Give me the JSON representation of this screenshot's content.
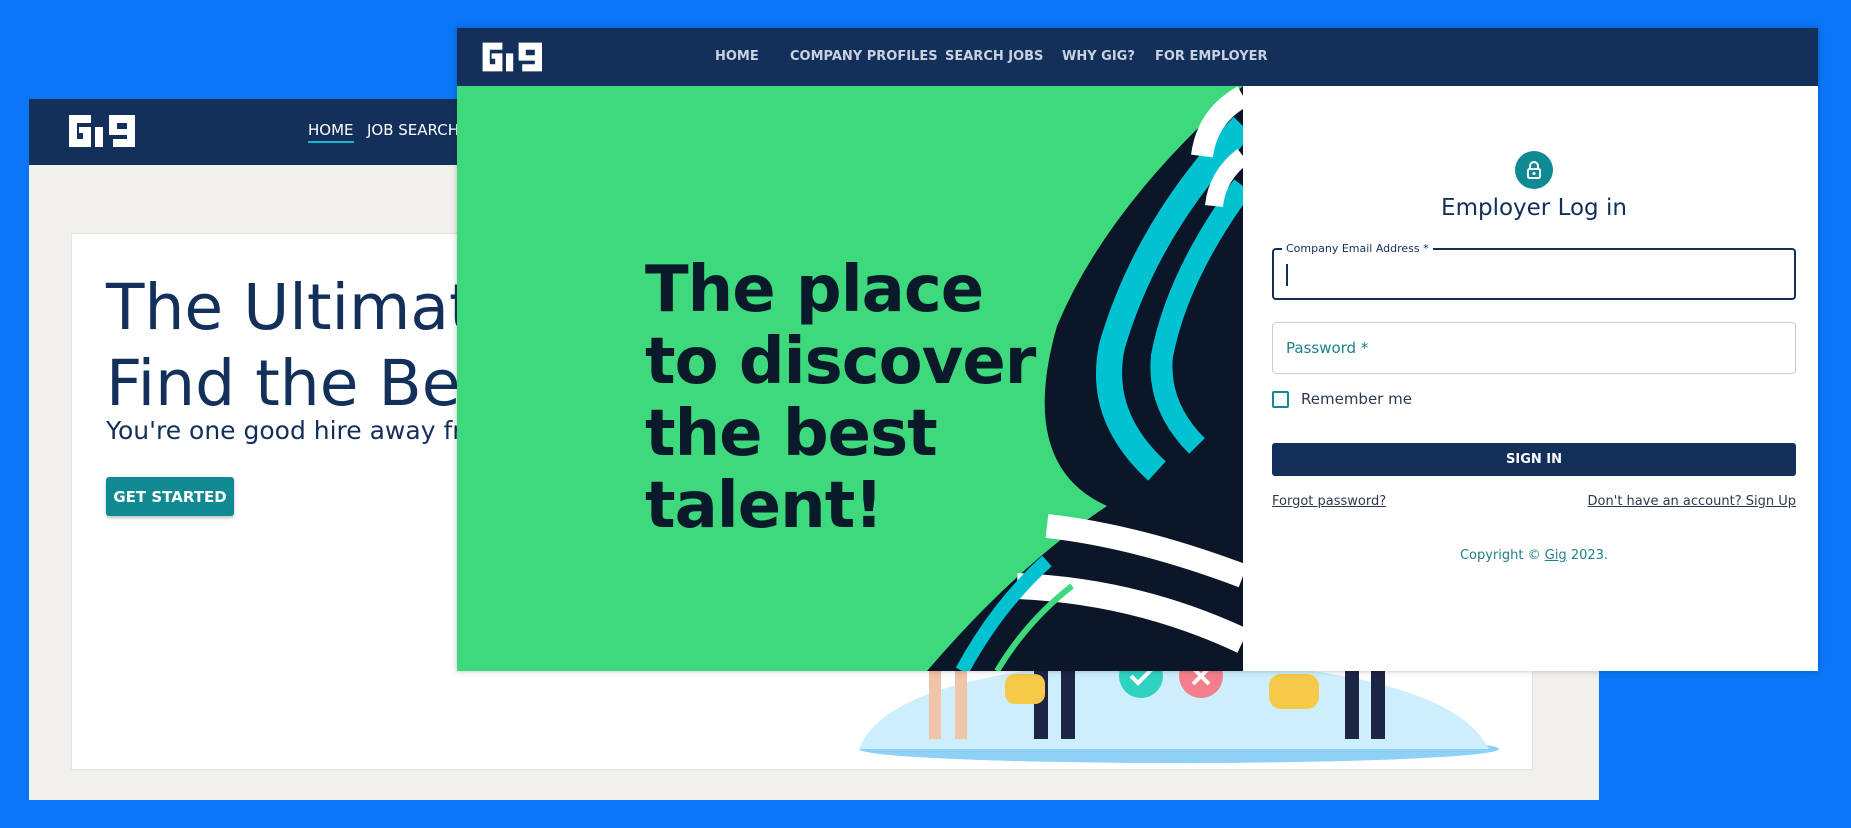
{
  "back_window": {
    "logo_text": "Gig",
    "nav": {
      "home": "HOME",
      "job_search": "JOB SEARCH"
    },
    "hero": {
      "title_line1": "The Ultimat",
      "title_line2": "Find the Bes",
      "subtitle": "You're one good hire away fr",
      "cta": "GET STARTED"
    }
  },
  "front_window": {
    "logo_text": "Gig",
    "nav": [
      "HOME",
      "COMPANY PROFILES",
      "SEARCH JOBS",
      "WHY GIG?",
      "FOR EMPLOYER"
    ],
    "hero_lines": [
      "The place",
      "to discover",
      "the best",
      "talent!"
    ],
    "login": {
      "title": "Employer Log in",
      "email_label": "Company Email Address *",
      "password_placeholder": "Password *",
      "remember_label": "Remember me",
      "sign_in": "SIGN IN",
      "forgot": "Forgot password?",
      "signup": "Don't have an account? Sign Up",
      "copyright_prefix": "Copyright © ",
      "copyright_link": "Gig",
      "copyright_suffix": " 2023."
    }
  },
  "colors": {
    "page_background": "#0a76f6",
    "nav_navy": "#12305a",
    "accent_teal": "#0f8a93",
    "hero_green": "#3ed97c",
    "stripe_cyan": "#00c2d1"
  },
  "icons": [
    "gig-logo",
    "lock-icon",
    "checkbox"
  ]
}
